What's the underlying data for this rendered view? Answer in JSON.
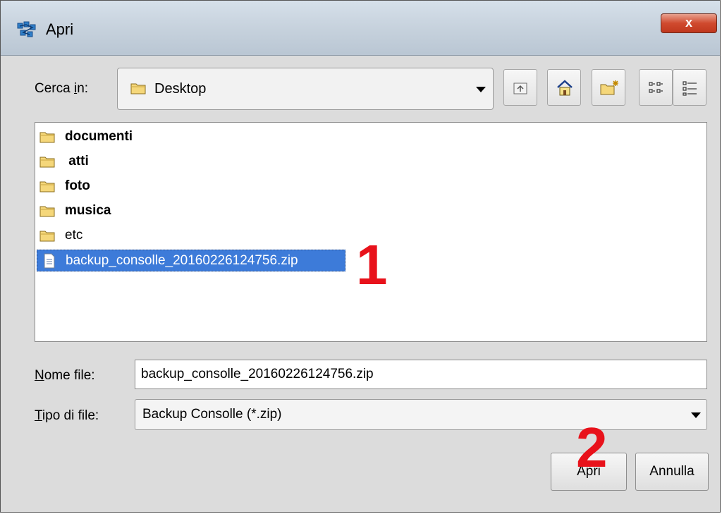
{
  "window": {
    "title": "Apri",
    "close_glyph": "x"
  },
  "lookin": {
    "label_prefix": "Cerca ",
    "label_underlined": "i",
    "label_suffix": "n:",
    "value": "Desktop",
    "icon": "folder-icon"
  },
  "toolbar": {
    "buttons": [
      "up-one-level-icon",
      "home-icon",
      "new-folder-icon",
      "list-view-icon",
      "details-view-icon"
    ]
  },
  "files": [
    {
      "name": "documenti",
      "type": "folder"
    },
    {
      "name": " atti",
      "type": "folder"
    },
    {
      "name": "foto",
      "type": "folder"
    },
    {
      "name": "musica",
      "type": "folder"
    },
    {
      "name": "etc",
      "type": "folder"
    },
    {
      "name": "backup_consolle_20160226124756.zip",
      "type": "file",
      "selected": true
    }
  ],
  "filename": {
    "label_underlined": "N",
    "label_rest": "ome file:",
    "value": "backup_consolle_20160226124756.zip"
  },
  "filetype": {
    "label_underlined": "T",
    "label_rest": "ipo di file:",
    "value": "Backup Consolle (*.zip)"
  },
  "buttons": {
    "open": "Apri",
    "cancel": "Annulla"
  },
  "annotations": {
    "step1": "1",
    "step2": "2"
  },
  "colors": {
    "selection": "#3d7bd9",
    "annotation": "#e8121b",
    "close_button": "#d04a2e"
  }
}
